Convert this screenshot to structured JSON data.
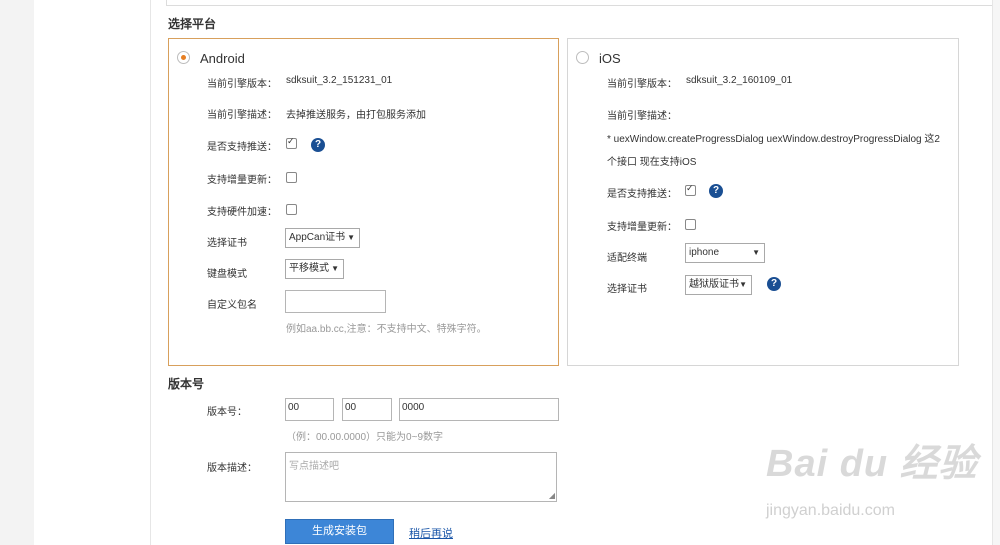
{
  "platform_section": {
    "title": "选择平台"
  },
  "android": {
    "name": "Android",
    "engine_version_label": "当前引擎版本：",
    "engine_version": "sdksuit_3.2_151231_01",
    "engine_desc_label": "当前引擎描述：",
    "engine_desc": "去掉推送服务，由打包服务添加",
    "push_label": "是否支持推送：",
    "incremental_label": "支持增量更新：",
    "hardware_accel_label": "支持硬件加速：",
    "cert_label": "选择证书",
    "cert_value": "AppCan证书",
    "keyboard_label": "键盘模式",
    "keyboard_value": "平移模式",
    "package_label": "自定义包名",
    "package_value": "",
    "package_hint": "例如aa.bb.cc,注意：不支持中文、特殊字符。"
  },
  "ios": {
    "name": "iOS",
    "engine_version_label": "当前引擎版本：",
    "engine_version": "sdksuit_3.2_160109_01",
    "engine_desc_label": "当前引擎描述：",
    "engine_desc_line1": "* uexWindow.createProgressDialog uexWindow.destroyProgressDialog 这2",
    "engine_desc_line2": "个接口 现在支持iOS",
    "push_label": "是否支持推送：",
    "incremental_label": "支持增量更新：",
    "device_label": "适配终端",
    "device_value": "iphone",
    "cert_label": "选择证书",
    "cert_value": "越狱版证书"
  },
  "help_glyph": "?",
  "version_section": {
    "title": "版本号",
    "version_label": "版本号：",
    "major": "00",
    "minor": "00",
    "build": "0000",
    "version_hint": "（例：00.00.0000）只能为0~9数字",
    "desc_label": "版本描述：",
    "desc_placeholder": "写点描述吧"
  },
  "actions": {
    "generate": "生成安装包",
    "later": "稍后再说"
  },
  "watermark": {
    "logo": "Bai du 经验",
    "url": "jingyan.baidu.com"
  }
}
